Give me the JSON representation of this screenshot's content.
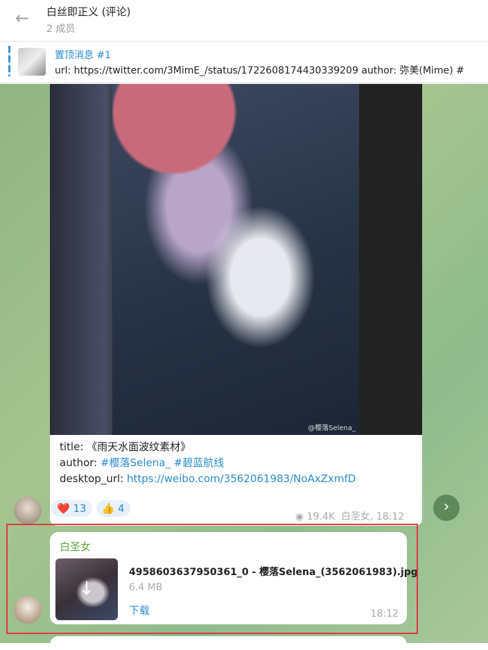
{
  "header": {
    "title": "白丝即正义 (评论)",
    "subtitle": "2 成员"
  },
  "pinned": {
    "title": "置顶消息 #1",
    "text": "url: https://twitter.com/3MimE_/status/1722608174430339209 author: 弥美(Mime) #"
  },
  "post": {
    "watermark": "@樱落Selena_",
    "title_line": "title: 《雨天水面波纹素材》",
    "author_label": "author: ",
    "author_tags": "#樱落Selena_ #碧蓝航线",
    "url_label": "desktop_url: ",
    "url": "https://weibo.com/3562061983/NoAxZxmfD",
    "reactions": [
      {
        "emoji": "❤️",
        "count": "13"
      },
      {
        "emoji": "👍",
        "count": "4"
      }
    ],
    "views": "19.4K",
    "meta": "白圣女, 18:12"
  },
  "file_msg": {
    "sender": "白圣女",
    "filename": "4958603637950361_0 - 樱落Selena_(3562061983).jpg",
    "size": "6.4 MB",
    "download": "下载",
    "time": "18:12"
  },
  "colors": {
    "accent": "#2a8bd0",
    "sender": "#5ea53a",
    "selection": "#e0383d"
  }
}
